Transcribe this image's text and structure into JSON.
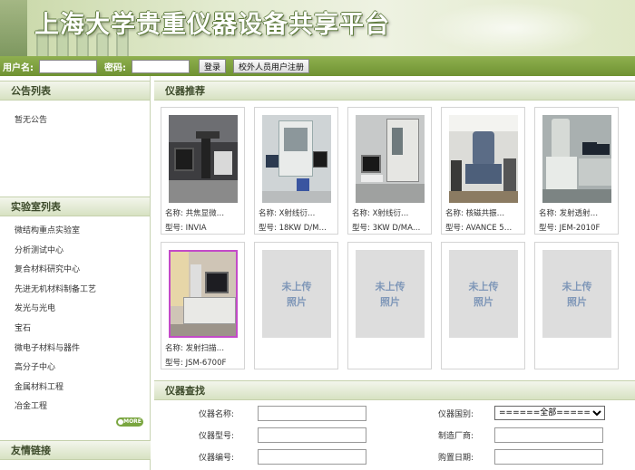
{
  "header": {
    "title": "上海大学贵重仪器设备共享平台"
  },
  "login": {
    "username_label": "用户名:",
    "password_label": "密码:",
    "login_button": "登录",
    "register_button": "校外人员用户注册"
  },
  "sidebar": {
    "notice_title": "公告列表",
    "notice_text": "暂无公告",
    "lab_title": "实验室列表",
    "labs": [
      "微结构重点实验室",
      "分析测试中心",
      "复合材料研究中心",
      "先进无机材料制备工艺",
      "发光与光电",
      "宝石",
      "微电子材料与器件",
      "高分子中心",
      "金属材料工程",
      "冶金工程"
    ],
    "more_label": "MORE",
    "links_title": "友情链接"
  },
  "recommend": {
    "title": "仪器推荐",
    "cards": [
      {
        "name": "名称: 共焦显微…",
        "model": "型号: INVIA",
        "photo": "microscope"
      },
      {
        "name": "名称: X射线衍…",
        "model": "型号: 18KW D/M…",
        "photo": "xrd"
      },
      {
        "name": "名称: X射线衍…",
        "model": "型号: 3KW D/MA…",
        "photo": "xrd2"
      },
      {
        "name": "名称: 核磁共振…",
        "model": "型号: AVANCE 5…",
        "photo": "nmr"
      },
      {
        "name": "名称: 发射透射…",
        "model": "型号: JEM-2010F",
        "photo": "tem"
      },
      {
        "name": "名称: 发射扫描…",
        "model": "型号: JSM-6700F",
        "photo": "sem"
      },
      {
        "name": "",
        "model": "",
        "photo": "none",
        "placeholder": [
          "未上传",
          "照片"
        ]
      },
      {
        "name": "",
        "model": "",
        "photo": "none",
        "placeholder": [
          "未上传",
          "照片"
        ]
      },
      {
        "name": "",
        "model": "",
        "photo": "none",
        "placeholder": [
          "未上传",
          "照片"
        ]
      },
      {
        "name": "",
        "model": "",
        "photo": "none",
        "placeholder": [
          "未上传",
          "照片"
        ]
      }
    ]
  },
  "search": {
    "title": "仪器查找",
    "name_label": "仪器名称:",
    "category_label": "仪器国别:",
    "category_value": "======全部======",
    "model_label": "仪器型号:",
    "manufacturer_label": "制造厂商:",
    "code_label": "仪器编号:",
    "purchase_label": "购置日期:"
  }
}
